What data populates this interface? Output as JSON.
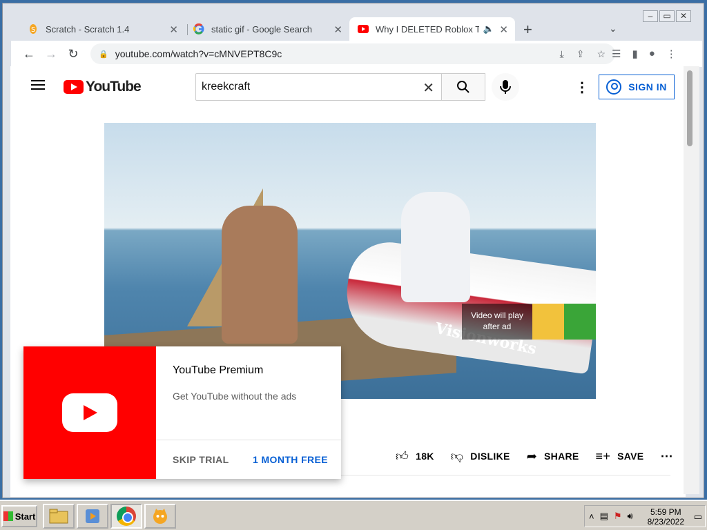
{
  "window": {
    "controls": [
      "minimize",
      "maximize",
      "close"
    ]
  },
  "tabs": [
    {
      "title": "Scratch - Scratch 1.4",
      "icon": "scratch-icon",
      "active": false
    },
    {
      "title": "static gif - Google Search",
      "icon": "google-icon",
      "active": false
    },
    {
      "title": "Why I DELETED Roblox TikTo",
      "icon": "youtube-icon",
      "active": true
    }
  ],
  "toolbar": {
    "url": "youtube.com/watch?v=cMNVEPT8C9c"
  },
  "youtube": {
    "logo_text": "YouTube",
    "search_value": "kreekcraft",
    "sign_in_label": "SIGN IN"
  },
  "video": {
    "brand_text": "Visionworks",
    "ad_badge_text": "Video will play after ad"
  },
  "actions": {
    "likes": "18K",
    "dislike_label": "DISLIKE",
    "share_label": "SHARE",
    "save_label": "SAVE"
  },
  "promo": {
    "title": "YouTube Premium",
    "subtitle": "Get YouTube without the ads",
    "skip_label": "SKIP TRIAL",
    "cta_label": "1 MONTH FREE"
  },
  "taskbar": {
    "start_label": "Start",
    "time": "5:59 PM",
    "date": "8/23/2022"
  },
  "colors": {
    "youtube_red": "#ff0000",
    "link_blue": "#065fd4"
  }
}
